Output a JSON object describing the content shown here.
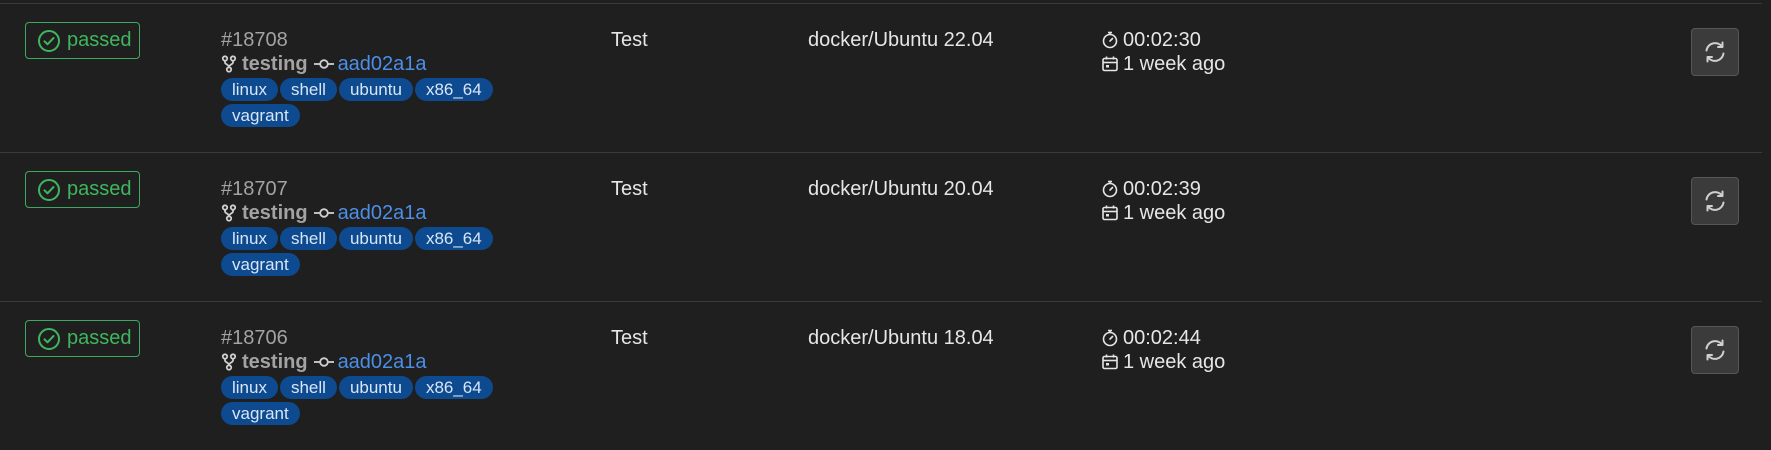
{
  "colors": {
    "background": "#1f1f1f",
    "passed": "#3fb65e",
    "commit_link": "#4b8fe8",
    "tag_bg": "#0d4a8f"
  },
  "icons": {
    "status": "check-circle-icon",
    "branch": "branch-icon",
    "commit": "commit-icon",
    "duration": "timer-icon",
    "finished": "calendar-icon",
    "retry": "retry-icon"
  },
  "jobs": [
    {
      "status": "passed",
      "id": "#18708",
      "branch": "testing",
      "commit": "aad02a1a",
      "tags": [
        "linux",
        "shell",
        "ubuntu",
        "x86_64",
        "vagrant"
      ],
      "stage": "Test",
      "name": "docker/Ubuntu 22.04",
      "duration": "00:02:30",
      "finished": "1 week ago"
    },
    {
      "status": "passed",
      "id": "#18707",
      "branch": "testing",
      "commit": "aad02a1a",
      "tags": [
        "linux",
        "shell",
        "ubuntu",
        "x86_64",
        "vagrant"
      ],
      "stage": "Test",
      "name": "docker/Ubuntu 20.04",
      "duration": "00:02:39",
      "finished": "1 week ago"
    },
    {
      "status": "passed",
      "id": "#18706",
      "branch": "testing",
      "commit": "aad02a1a",
      "tags": [
        "linux",
        "shell",
        "ubuntu",
        "x86_64",
        "vagrant"
      ],
      "stage": "Test",
      "name": "docker/Ubuntu 18.04",
      "duration": "00:02:44",
      "finished": "1 week ago"
    }
  ]
}
